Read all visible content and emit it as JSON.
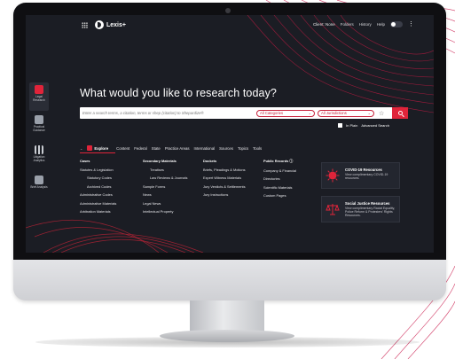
{
  "app": {
    "name": "Lexis+",
    "colors": {
      "accent": "#e0243a",
      "background": "#1b1d24",
      "text": "#ffffff"
    }
  },
  "topnav": {
    "client": "Client: None",
    "folders": "Folders",
    "history": "History",
    "help": "Help"
  },
  "rail": [
    {
      "label": "Legal Research",
      "icon": "legal-research-icon",
      "active": true
    },
    {
      "label": "Practical Guidance",
      "icon": "practical-guidance-icon",
      "active": false
    },
    {
      "label": "Litigation Analytics",
      "icon": "litigation-analytics-icon",
      "active": false
    },
    {
      "label": "Brief Analysis",
      "icon": "brief-analysis-icon",
      "active": false
    }
  ],
  "headline": "What would you like to research today?",
  "search": {
    "placeholder": "Enter a search terms, a citation, terms or shep (citation) to Shepardize®",
    "category": "All Categories",
    "jurisdiction": "All Jurisdictions",
    "in_plain": "In Plain",
    "advanced": "Advanced Search"
  },
  "tabs": {
    "explore": "Explore",
    "items": [
      "Content",
      "Federal",
      "State",
      "Practice Areas",
      "International",
      "Sources",
      "Topics",
      "Tools"
    ]
  },
  "explore": {
    "columns": [
      {
        "head": "Cases",
        "items": [
          {
            "label": "Statutes & Legislation",
            "indent": false
          },
          {
            "label": "Statutory Codes",
            "indent": true
          },
          {
            "label": "Archived Codes",
            "indent": true
          },
          {
            "label": "Administrative Codes",
            "indent": false
          },
          {
            "label": "Administrative Materials",
            "indent": false
          },
          {
            "label": "Arbitration Materials",
            "indent": false
          }
        ]
      },
      {
        "head": "Secondary Materials",
        "items": [
          {
            "label": "Treatises",
            "indent": true
          },
          {
            "label": "Law Reviews & Journals",
            "indent": true
          },
          {
            "label": "Sample Forms",
            "indent": false
          },
          {
            "label": "News",
            "indent": false
          },
          {
            "label": "Legal News",
            "indent": false
          },
          {
            "label": "Intellectual Property",
            "indent": false
          }
        ]
      },
      {
        "head": "Dockets",
        "items": [
          {
            "label": "Briefs, Pleadings & Motions",
            "indent": false
          },
          {
            "label": "Expert Witness Materials",
            "indent": false
          },
          {
            "label": "Jury Verdicts & Settlements",
            "indent": false
          },
          {
            "label": "Jury Instructions",
            "indent": false
          }
        ]
      },
      {
        "head": "Public Records ⓘ",
        "items": [
          {
            "label": "Company & Financial",
            "indent": false
          },
          {
            "label": "Directories",
            "indent": false
          },
          {
            "label": "Scientific Materials",
            "indent": false
          },
          {
            "label": "Custom Pages",
            "indent": false
          }
        ]
      }
    ]
  },
  "cards": [
    {
      "title": "COVID-19 Resources",
      "desc": "View complimentary COVID-19 resources.",
      "icon": "covid-virus-icon",
      "color": "#e0243a"
    },
    {
      "title": "Social Justice Resources",
      "desc": "View complimentary Racial Equality, Police Reform & Protesters' Rights Resources.",
      "icon": "scales-of-justice-icon",
      "color": "#e0243a"
    }
  ]
}
